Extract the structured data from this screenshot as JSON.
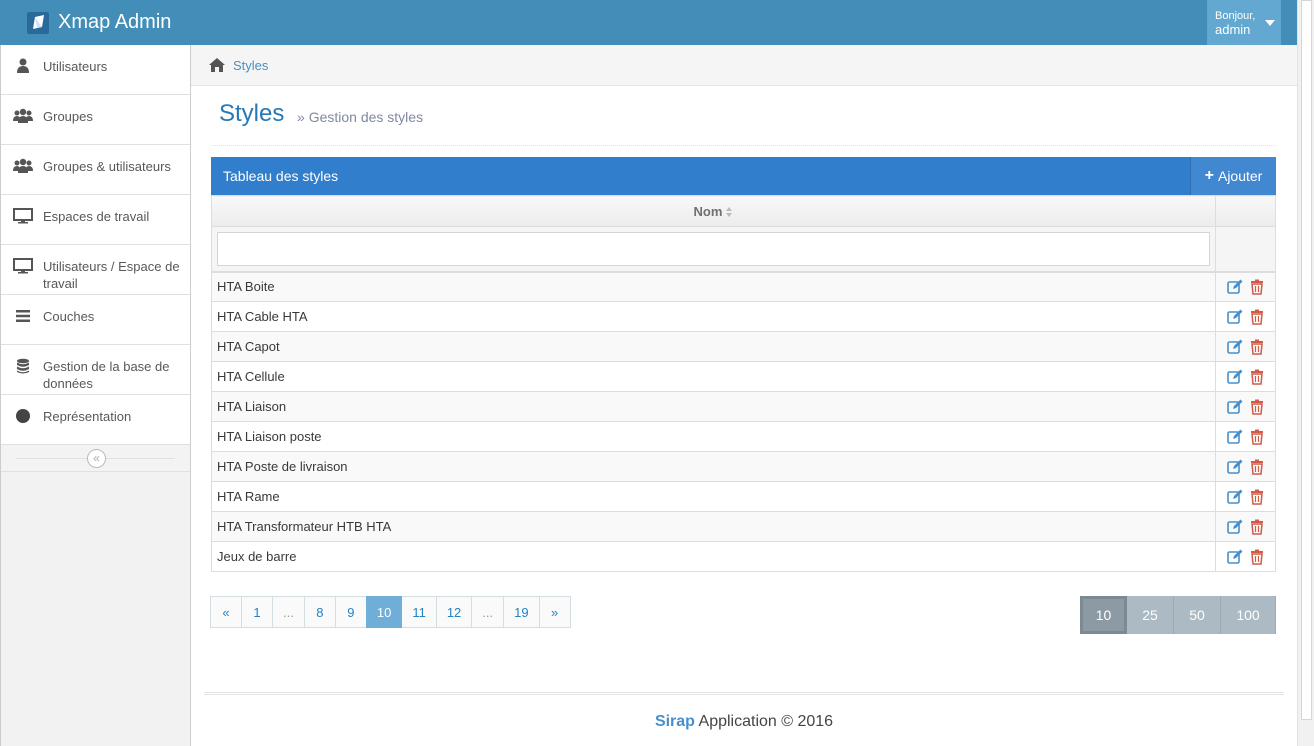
{
  "navbar": {
    "brand": "Xmap Admin",
    "user_greeting": "Bonjour,",
    "user_name": "admin"
  },
  "sidebar": {
    "items": [
      {
        "label": "Utilisateurs",
        "icon": "user-icon"
      },
      {
        "label": "Groupes",
        "icon": "users-icon"
      },
      {
        "label": "Groupes & utilisateurs",
        "icon": "users-icon"
      },
      {
        "label": "Espaces de travail",
        "icon": "desktop-icon"
      },
      {
        "label": "Utilisateurs / Espace de travail",
        "icon": "desktop-icon"
      },
      {
        "label": "Couches",
        "icon": "bars-icon"
      },
      {
        "label": "Gestion de la base de données",
        "icon": "database-icon"
      },
      {
        "label": "Représentation",
        "icon": "circle-icon"
      }
    ],
    "collapse_icon": "double-chevron-left-icon"
  },
  "breadcrumb": {
    "current": "Styles"
  },
  "page": {
    "title": "Styles",
    "subtitle": "Gestion des styles"
  },
  "table": {
    "header_title": "Tableau des styles",
    "add_label": "Ajouter",
    "column_name": "Nom",
    "rows": [
      "HTA Boite",
      "HTA Cable HTA",
      "HTA Capot",
      "HTA Cellule",
      "HTA Liaison",
      "HTA Liaison poste",
      "HTA Poste de livraison",
      "HTA Rame",
      "HTA Transformateur HTB HTA",
      "Jeux de barre"
    ]
  },
  "pagination": {
    "pages": [
      "«",
      "1",
      "...",
      "8",
      "9",
      "10",
      "11",
      "12",
      "...",
      "19",
      "»"
    ],
    "active": "10"
  },
  "page_sizes": {
    "options": [
      "10",
      "25",
      "50",
      "100"
    ],
    "active": "10"
  },
  "footer": {
    "brand": "Sirap",
    "text": "Application © 2016"
  },
  "colors": {
    "navbar": "#438eb9",
    "table_header": "#307ecc",
    "active_page": "#6faed9",
    "delete": "#d15b47",
    "edit": "#478fca"
  }
}
